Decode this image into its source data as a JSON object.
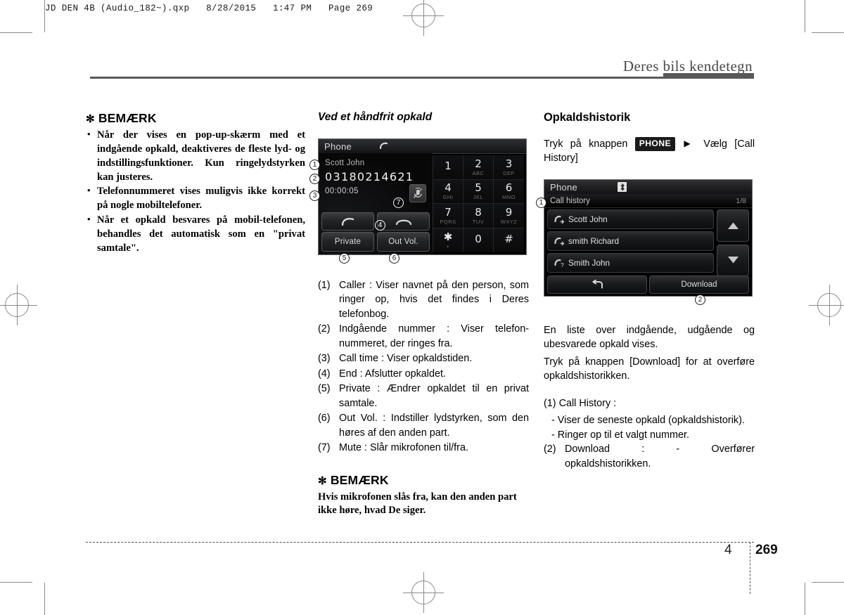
{
  "print_header": "JD DEN 4B (Audio_182~).qxp   8/28/2015   1:47 PM   Page 269",
  "running_head": "Deres bils kendetegn",
  "footer": {
    "chapter": "4",
    "page": "269"
  },
  "left_column": {
    "note_title": "BEMÆRK",
    "note_asterisk": "✻",
    "bullets": [
      "Når der vises en pop-up-skærm med et indgående opkald, deaktiveres de fleste lyd- og indstillingsfunktioner. Kun ringelydstyrken kan justeres.",
      "Telefonnummeret vises muligvis ikke korrekt på nogle mobiltelefoner.",
      "Når et opkald besvares på mobil-telefonen, behandles det automatisk som en \"privat samtale\"."
    ]
  },
  "mid_column": {
    "subhead": "Ved et håndfrit opkald",
    "call_screen": {
      "title": "Phone",
      "caller_name": "Scott John",
      "caller_number": "03180214621",
      "call_time": "00:00:05",
      "private_label": "Private",
      "out_vol_label": "Out Vol.",
      "keypad": [
        {
          "digit": "1",
          "sub": ""
        },
        {
          "digit": "2",
          "sub": "ABC"
        },
        {
          "digit": "3",
          "sub": "DEF"
        },
        {
          "digit": "4",
          "sub": "GHI"
        },
        {
          "digit": "5",
          "sub": "JKL"
        },
        {
          "digit": "6",
          "sub": "MNO"
        },
        {
          "digit": "7",
          "sub": "PQRS"
        },
        {
          "digit": "8",
          "sub": "TUV"
        },
        {
          "digit": "9",
          "sub": "WXYZ"
        },
        {
          "digit": "✱",
          "sub": "+"
        },
        {
          "digit": "0",
          "sub": ""
        },
        {
          "digit": "#",
          "sub": ""
        }
      ],
      "callouts": [
        "1",
        "2",
        "3",
        "4",
        "5",
        "6",
        "7"
      ]
    },
    "captions": [
      {
        "num": "(1)",
        "text": "Caller : Viser navnet på den person, som ringer op, hvis det findes i Deres telefonbog."
      },
      {
        "num": "(2)",
        "text": "Indgående nummer : Viser telefon-nummeret, der ringes fra."
      },
      {
        "num": "(3)",
        "text": "Call time : Viser opkaldstiden."
      },
      {
        "num": "(4)",
        "text": "End : Afslutter opkaldet."
      },
      {
        "num": "(5)",
        "text": "Private : Ændrer opkaldet til en privat samtale."
      },
      {
        "num": "(6)",
        "text": "Out Vol. : Indstiller lydstyrken, som den høres af den anden part."
      },
      {
        "num": "(7)",
        "text": "Mute : Slår mikrofonen til/fra."
      }
    ],
    "note_title": "BEMÆRK",
    "note_asterisk": "✻",
    "note_body": "Hvis mikrofonen slås fra, kan den anden part ikke høre, hvad De siger."
  },
  "right_column": {
    "section_title": "Opkaldshistorik",
    "instruction_pre": "Tryk på knappen",
    "instruction_key": "PHONE",
    "instruction_arrow": "▶",
    "instruction_post": "Vælg [Call History]",
    "history_screen": {
      "title": "Phone",
      "subtitle": "Call history",
      "page_indicator": "1/8",
      "items": [
        {
          "name": "Scott John",
          "icon": "call-outgoing-icon"
        },
        {
          "name": "smith Richard",
          "icon": "call-outgoing-icon"
        },
        {
          "name": "Smith John",
          "icon": "call-missed-icon"
        }
      ],
      "back_label": "↰",
      "download_label": "Download",
      "callouts": [
        "1",
        "2"
      ]
    },
    "paragraphs": [
      "En liste over indgående, udgående og ubesvarede opkald vises.",
      "Tryk på knappen [Download] for at overføre opkaldshistorikken."
    ],
    "desc_heading": "(1) Call History :",
    "desc_items": [
      "- Viser de seneste opkald (opkaldshistorik).",
      "- Ringer op til et valgt nummer."
    ],
    "desc_download_num": "(2)",
    "desc_download": "Download : - Overfører opkaldshistorikken."
  }
}
